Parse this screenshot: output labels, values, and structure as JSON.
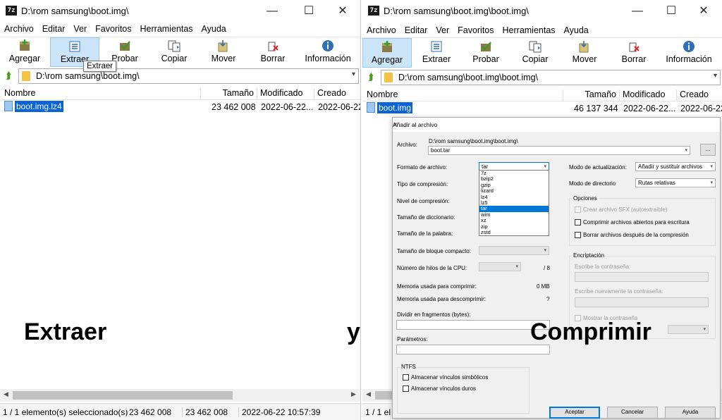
{
  "left": {
    "title": "D:\\rom samsung\\boot.img\\",
    "menu": [
      "Archivo",
      "Editar",
      "Ver",
      "Favoritos",
      "Herramientas",
      "Ayuda"
    ],
    "toolbar": [
      "Agregar",
      "Extraer",
      "Probar",
      "Copiar",
      "Mover",
      "Borrar",
      "Información"
    ],
    "tooltip": "Extraer",
    "address": "D:\\rom samsung\\boot.img\\",
    "columns": [
      "Nombre",
      "Tamaño",
      "Modificado",
      "Creado"
    ],
    "file": {
      "name": "boot.img.lz4",
      "size": "23 462 008",
      "modified": "2022-06-22...",
      "created": "2022-06-22..."
    },
    "status": [
      "1 / 1 elemento(s) seleccionado(s)",
      "23 462 008",
      "23 462 008",
      "2022-06-22 10:57:39"
    ]
  },
  "right": {
    "title": "D:\\rom samsung\\boot.img\\boot.img\\",
    "menu": [
      "Archivo",
      "Editar",
      "Ver",
      "Favoritos",
      "Herramientas",
      "Ayuda"
    ],
    "toolbar": [
      "Agregar",
      "Extraer",
      "Probar",
      "Copiar",
      "Mover",
      "Borrar",
      "Información"
    ],
    "address": "D:\\rom samsung\\boot.img\\boot.img\\",
    "columns": [
      "Nombre",
      "Tamaño",
      "Modificado",
      "Creado"
    ],
    "file": {
      "name": "boot.img",
      "size": "46 137 344",
      "modified": "2022-06-22...",
      "created": "2022-06-22..."
    },
    "status": "1 / 1 el"
  },
  "overlay": {
    "left_text": "Extraer",
    "mid_text": "y",
    "right_text": "Comprimir"
  },
  "dialog": {
    "title": "Añadir al archivo",
    "archive_label": "Archivo:",
    "archive_path": "D:\\rom samsung\\boot.img\\boot.img\\",
    "archive_name": "boot.tar",
    "browse": "...",
    "format_label": "Formato de archivo:",
    "format_value": "tar",
    "format_options": [
      "7z",
      "bzip2",
      "gzip",
      "lizard",
      "lz4",
      "lz5",
      "tar",
      "wim",
      "xz",
      "zip",
      "zstd"
    ],
    "format_selected_index": 6,
    "compression_type_label": "Tipo de compresión:",
    "compression_level_label": "Nivel de compresión:",
    "dict_size_label": "Tamaño de diccionario:",
    "word_size_label": "Tamaño de la palabra:",
    "block_size_label": "Tamaño de bloque compacto:",
    "threads_label": "Número de hilos de la CPU:",
    "threads_max": "/ 8",
    "mem_compress_label": "Memoria usada para comprimir:",
    "mem_compress_value": "0 MB",
    "mem_decompress_label": "Memoria usada para descomprimir:",
    "mem_decompress_value": "?",
    "split_label": "Dividir en fragmentos (bytes):",
    "params_label": "Parámetros:",
    "update_mode_label": "Modo de actualización:",
    "update_mode_value": "Añadir y sustituir archivos",
    "path_mode_label": "Modo de directorio",
    "path_mode_value": "Rutas relativas",
    "options_title": "Opciones",
    "opt_sfx": "Crear archivo SFX (autoextraíble)",
    "opt_shared": "Comprimir archivos abiertos para escritura",
    "opt_delete": "Borrar archivos después de la compresión",
    "encryption_title": "Encriptación",
    "enc_password": "Escribe la contraseña:",
    "enc_password2": "Escribe nuevamente la contraseña:",
    "enc_show": "Mostrar la contraseña",
    "ntfs_title": "NTFS",
    "ntfs_symlinks": "Almacenar vínculos simbólicos",
    "ntfs_hardlinks": "Almacenar vínculos duros",
    "btn_ok": "Aceptar",
    "btn_cancel": "Cancelar",
    "btn_help": "Ayuda"
  }
}
